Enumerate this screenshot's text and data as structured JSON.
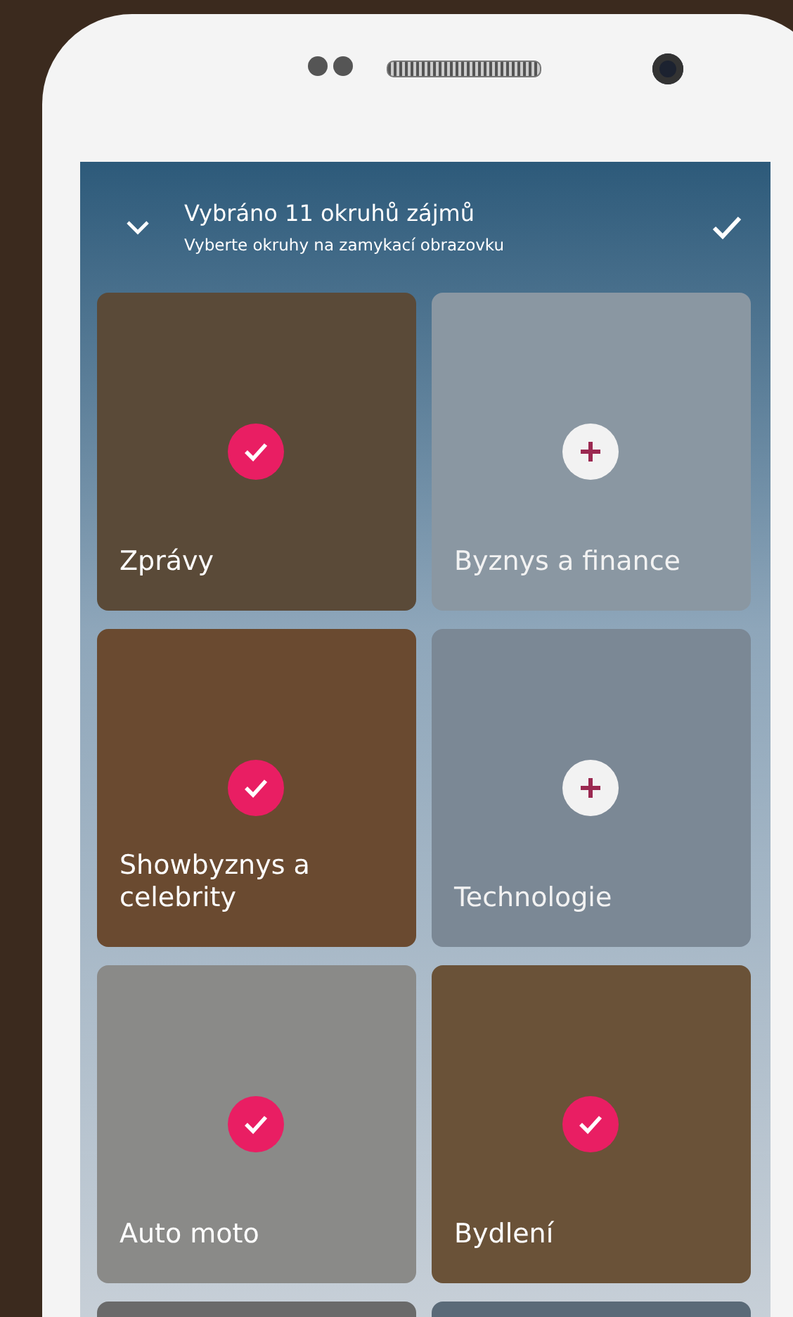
{
  "header": {
    "title": "Vybráno 11 okruhů zájmů",
    "subtitle": "Vyberte okruhy na zamykací obrazovku"
  },
  "tiles": [
    {
      "label": "Zprávy",
      "selected": true
    },
    {
      "label": "Byznys a finance",
      "selected": false
    },
    {
      "label": "Showbyznys a celebrity",
      "selected": true
    },
    {
      "label": "Technologie",
      "selected": false
    },
    {
      "label": "Auto moto",
      "selected": true
    },
    {
      "label": "Bydlení",
      "selected": true
    }
  ]
}
